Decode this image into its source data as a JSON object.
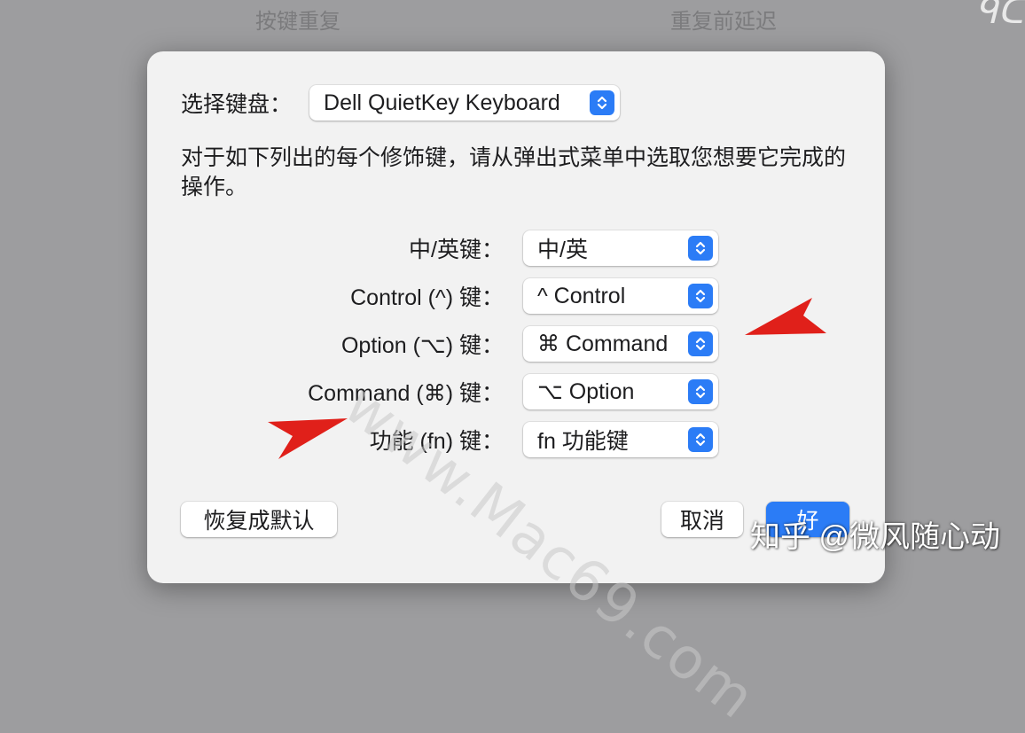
{
  "background": {
    "left_label": "按键重复",
    "right_label": "重复前延迟",
    "corner_glyph": "ᑫᑕ"
  },
  "dialog": {
    "keyboard_label": "选择键盘：",
    "keyboard_value": "Dell QuietKey Keyboard",
    "description": "对于如下列出的每个修饰键，请从弹出式菜单中选取您想要它完成的操作。",
    "modifiers": [
      {
        "label": "中/英键：",
        "value": "中/英"
      },
      {
        "label": "Control (^) 键：",
        "value": "^ Control"
      },
      {
        "label": "Option (⌥) 键：",
        "value": "⌘ Command"
      },
      {
        "label": "Command (⌘) 键：",
        "value": "⌥ Option"
      },
      {
        "label": "功能 (fn) 键：",
        "value": "fn 功能键"
      }
    ],
    "buttons": {
      "restore_default": "恢复成默认",
      "cancel": "取消",
      "ok": "好"
    }
  },
  "overlay": {
    "watermark": "www.Mac69.com",
    "credit": "知乎 @微风随心动"
  },
  "colors": {
    "accent": "#2b7cf6",
    "arrow": "#e0201a",
    "sheet": "#f2f2f2"
  }
}
